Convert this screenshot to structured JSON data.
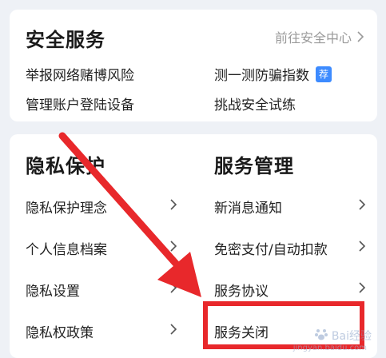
{
  "security": {
    "title": "安全服务",
    "link": "前往安全中心",
    "items": [
      {
        "label": "举报网络赌博风险"
      },
      {
        "label": "测一测防骗指数",
        "badge": "荐"
      },
      {
        "label": "管理账户登陆设备"
      },
      {
        "label": "挑战安全试练"
      }
    ]
  },
  "privacy": {
    "title": "隐私保护",
    "items": [
      "隐私保护理念",
      "个人信息档案",
      "隐私设置",
      "隐私权政策"
    ]
  },
  "service": {
    "title": "服务管理",
    "items": [
      "新消息通知",
      "免密支付/自动扣款",
      "服务协议",
      "服务关闭"
    ]
  },
  "watermark": {
    "brand": "Bai经验",
    "url": "jingyan.baidu.com"
  },
  "colors": {
    "accent": "#3d8bff",
    "annotation": "#e8282b"
  }
}
